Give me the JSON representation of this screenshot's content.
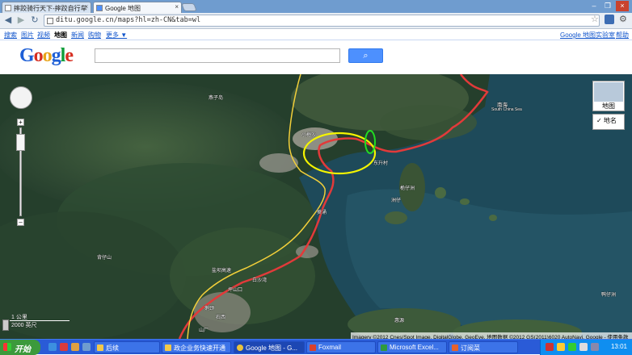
{
  "browser": {
    "tabs": [
      {
        "label": "摔跤骑行天下-摔跤自行车"
      },
      {
        "label": "Google 地图"
      }
    ],
    "url": "ditu.google.cn/maps?hl=zh-CN&tab=wl"
  },
  "google_bar": {
    "links": [
      "搜索",
      "图片",
      "视频",
      "地图",
      "新闻",
      "购物",
      "更多 ▼"
    ],
    "current": "地图",
    "right_links": [
      "Google 地图实验室",
      "帮助"
    ]
  },
  "header": {
    "logo": "Google",
    "search_value": "",
    "search_button_icon": "magnifier-icon"
  },
  "map": {
    "map_type_label": "地图",
    "layer_label": "✓ 地名",
    "scale_metric": "1 公里",
    "scale_imperial": "2000 英尺",
    "credit": "Imagery ©2012 Cnes/Spot Image, DigitalGlobe, GeoEye, 地图数据 ©2012 GS(2011)6020 AutoNavi, Google - 使用条款",
    "labels": {
      "mountain1": "燕子岛",
      "south_sea": "南海",
      "south_china_sea": "South China Sea",
      "town1": "小梅沙",
      "town2": "东升村",
      "island": "桅仔洲",
      "island2": "洲仔",
      "place1": "葵涌",
      "place2": "背仔山",
      "place3": "白沙湾",
      "place4": "坪山口",
      "place5": "鹅颈",
      "place6": "石西",
      "place7": "山厂",
      "place8": "鸭仔洲",
      "place9": "惠源",
      "road": "盐坝高速"
    },
    "colors": {
      "highlight_ellipse": "#f4f400",
      "green_ellipse": "#22dd22",
      "boundary_red": "#e23a3a",
      "road_yellow": "#f2cf3a"
    }
  },
  "taskbar": {
    "start_label": "开始",
    "items": [
      {
        "label": "后续"
      },
      {
        "label": "政企业务快速开通"
      },
      {
        "label": "Google 地图 - G..."
      },
      {
        "label": "Foxmail"
      },
      {
        "label": "Microsoft Excel..."
      },
      {
        "label": "订阅菜"
      }
    ],
    "clock": "13:01"
  }
}
